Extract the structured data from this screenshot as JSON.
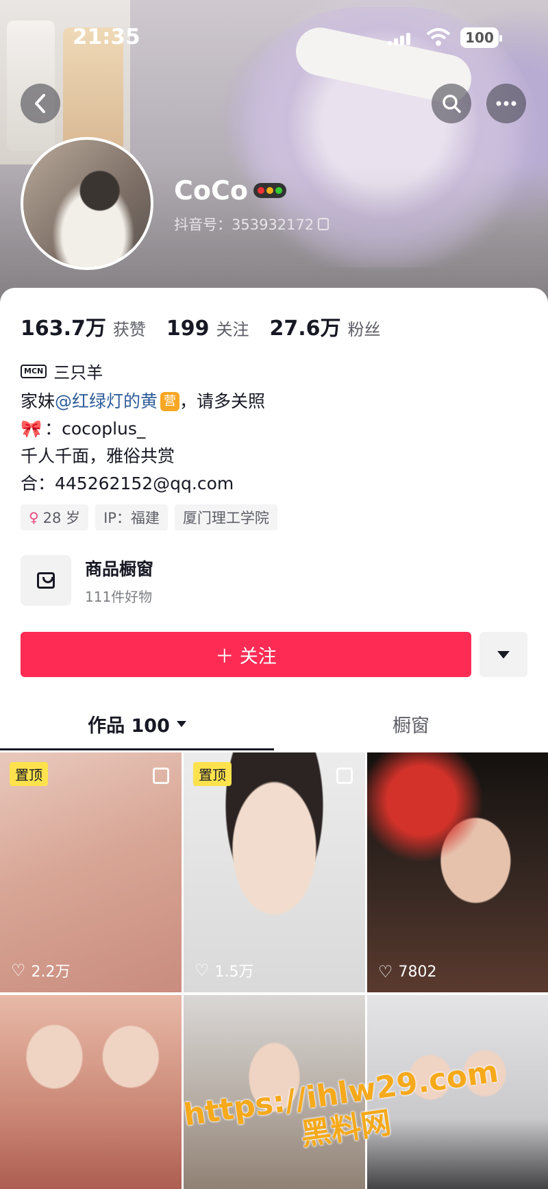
{
  "status": {
    "time": "21:35",
    "battery": "100"
  },
  "profile": {
    "nickname": "CoCo",
    "douyin_id": "抖音号：353932172",
    "stats": [
      {
        "num": "163.7万",
        "label": "获赞"
      },
      {
        "num": "199",
        "label": "关注"
      },
      {
        "num": "27.6万",
        "label": "粉丝"
      }
    ],
    "mcn_badge": "MCN",
    "mcn": "三只羊",
    "bio": {
      "line1_prefix": "家妹",
      "line1_mention": "@红绿灯的黄",
      "line1_badge": "营",
      "line1_suffix": "，请多关照",
      "line2": "：cocoplus_",
      "line3": "千人千面，雅俗共赏",
      "line4": "合：445262152@qq.com"
    },
    "tags": [
      "28 岁",
      "IP：福建",
      "厦门理工学院"
    ]
  },
  "shop": {
    "title": "商品橱窗",
    "subtitle": "111件好物"
  },
  "follow_label": "＋ 关注",
  "tabs": {
    "works": "作品 100",
    "window": "橱窗"
  },
  "videos": [
    {
      "pinned": "置顶",
      "likes": "2.2万"
    },
    {
      "pinned": "置顶",
      "likes": "1.5万"
    },
    {
      "pinned": "",
      "likes": "7802"
    },
    {
      "pinned": "",
      "likes": ""
    },
    {
      "pinned": "",
      "likes": ""
    },
    {
      "pinned": "",
      "likes": ""
    }
  ],
  "watermark": {
    "line1": "https://ihlw29.com",
    "line2": "黑料网"
  },
  "icons": [
    "back-icon",
    "search-icon",
    "more-icon",
    "copy-icon",
    "bag-icon",
    "dropdown-icon",
    "heart-icon"
  ]
}
